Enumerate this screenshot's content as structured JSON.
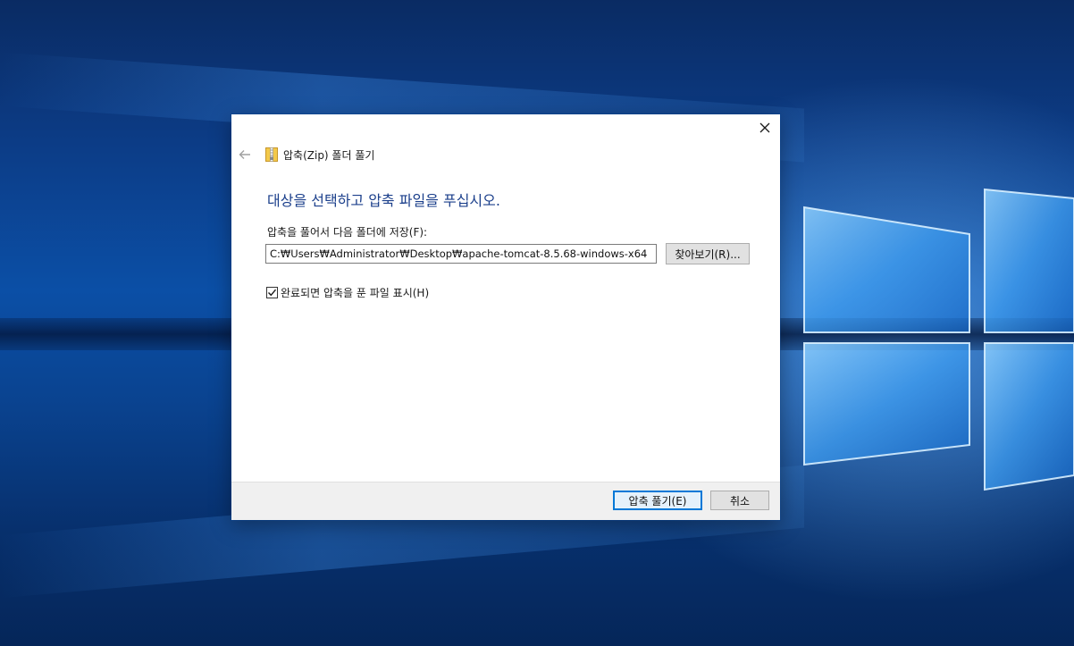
{
  "window": {
    "title": "압축(Zip) 폴더 풀기",
    "close_icon": "close-icon",
    "back_icon": "back-arrow-icon",
    "folder_icon": "zip-folder-icon"
  },
  "main": {
    "heading": "대상을 선택하고 압축 파일을 푸십시오.",
    "destination_label": "압축을 풀어서 다음 폴더에 저장(F):",
    "destination_path": "C:₩Users₩Administrator₩Desktop₩apache-tomcat-8.5.68-windows-x64",
    "browse_label": "찾아보기(R)...",
    "show_files_label": "완료되면 압축을 푼 파일 표시(H)",
    "show_files_checked": true
  },
  "footer": {
    "extract_label": "압축 풀기(E)",
    "cancel_label": "취소"
  },
  "colors": {
    "accent": "#0078d7",
    "heading": "#1b3f8b",
    "desktop": "#0b4fa6"
  }
}
